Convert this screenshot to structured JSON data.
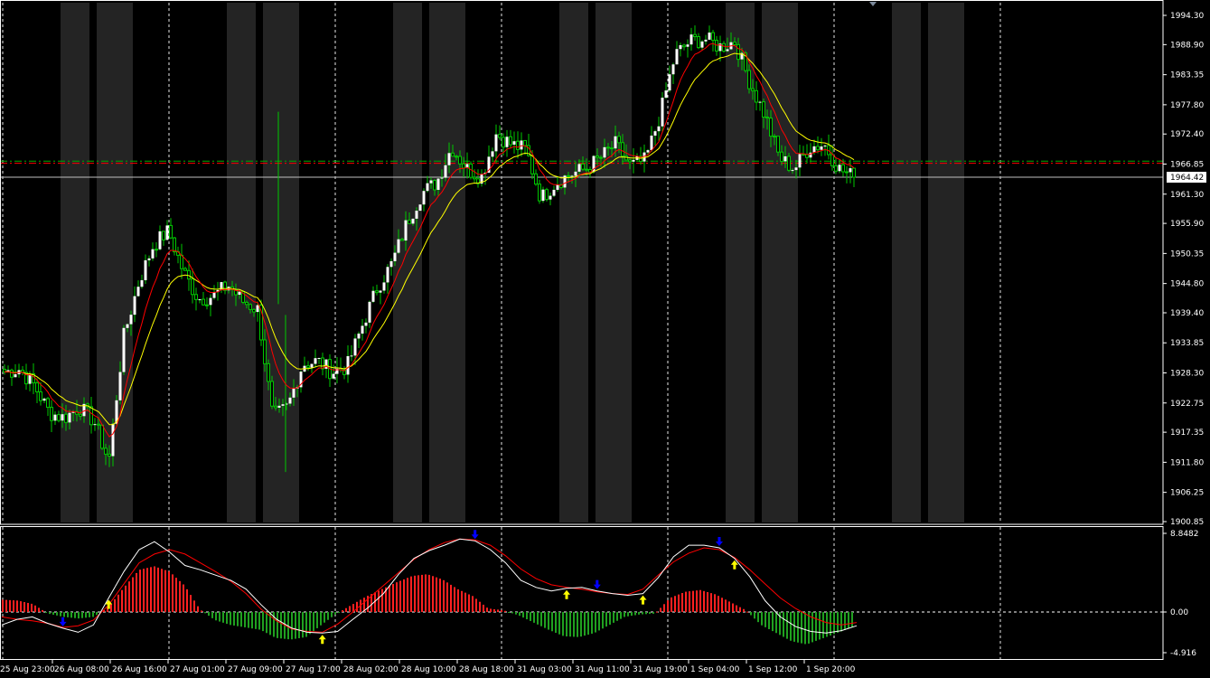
{
  "colors": {
    "background": "#000000",
    "grid": "#ffffff",
    "band": "#242424",
    "bull_candle": "#ffffff",
    "wick": "#00c800",
    "ma_fast": "#ff0000",
    "ma_slow": "#ffff00",
    "hline_green": "#00aa00",
    "hline_red": "#ff0000",
    "current_line": "#c0c0c0",
    "hist_positive": "#ff2020",
    "hist_negative": "#20a020",
    "osc_white": "#ffffff",
    "osc_red": "#ff0000",
    "arrow_up": "#ffff00",
    "arrow_down": "#0000ff"
  },
  "price_axis": {
    "labels": [
      "1994.30",
      "1988.90",
      "1983.35",
      "1977.80",
      "1972.40",
      "1966.85",
      "1961.30",
      "1955.90",
      "1950.35",
      "1944.80",
      "1939.40",
      "1933.85",
      "1928.30",
      "1922.75",
      "1917.35",
      "1911.80",
      "1906.25",
      "1900.85"
    ],
    "current_price": "1964.42",
    "level_green": 1967.4,
    "level_red": 1967.0
  },
  "indicator_axis": {
    "labels": [
      "8.8482",
      "0.00",
      "-4.916"
    ]
  },
  "time_axis": {
    "labels": [
      "25 Aug 23:00",
      "26 Aug 08:00",
      "26 Aug 16:00",
      "27 Aug 01:00",
      "27 Aug 09:00",
      "27 Aug 17:00",
      "28 Aug 02:00",
      "28 Aug 10:00",
      "28 Aug 18:00",
      "31 Aug 03:00",
      "31 Aug 11:00",
      "31 Aug 19:00",
      "1 Sep 04:00",
      "1 Sep 12:00",
      "1 Sep 20:00"
    ]
  },
  "chart_data": {
    "type": "candlestick",
    "ylim": [
      1900.85,
      1995.5
    ],
    "grid": true,
    "x_categories": [
      "25 Aug 23:00",
      "26 Aug 08:00",
      "26 Aug 16:00",
      "27 Aug 01:00",
      "27 Aug 09:00",
      "27 Aug 17:00",
      "28 Aug 02:00",
      "28 Aug 10:00",
      "28 Aug 18:00",
      "31 Aug 03:00",
      "31 Aug 11:00",
      "31 Aug 19:00",
      "1 Sep 04:00",
      "1 Sep 12:00",
      "1 Sep 20:00"
    ],
    "close_path": [
      1928.5,
      1929.0,
      1926.0,
      1921.0,
      1920.0,
      1922.0,
      1919.5,
      1912.0,
      1935.0,
      1945.0,
      1952.0,
      1954.5,
      1947.0,
      1942.0,
      1942.5,
      1944.5,
      1941.5,
      1940.0,
      1920.0,
      1922.0,
      1930.0,
      1930.5,
      1928.5,
      1929.5,
      1937.0,
      1944.0,
      1948.5,
      1956.0,
      1961.5,
      1963.5,
      1970.0,
      1966.0,
      1964.5,
      1972.5,
      1970.5,
      1969.5,
      1960.5,
      1963.5,
      1965.0,
      1966.0,
      1968.0,
      1970.5,
      1966.5,
      1967.5,
      1976.0,
      1987.0,
      1989.5,
      1990.0,
      1988.5,
      1989.5,
      1982.0,
      1976.0,
      1968.0,
      1966.0,
      1970.0,
      1970.5,
      1966.0,
      1964.42
    ],
    "ma_fast_period": "fast",
    "ma_slow_period": "slow",
    "oscillator": {
      "ylim": [
        -4.916,
        8.8482
      ],
      "histogram": [
        1.4,
        1.3,
        0.9,
        -0.2,
        -0.6,
        -0.8,
        -0.6,
        0.6,
        2.8,
        4.8,
        5.2,
        4.6,
        3.0,
        0.3,
        -1.0,
        -1.6,
        -1.9,
        -2.2,
        -3.2,
        -3.4,
        -3.1,
        -1.6,
        -0.2,
        0.8,
        1.8,
        2.6,
        3.4,
        4.1,
        4.3,
        3.7,
        2.6,
        1.8,
        0.4,
        0.2,
        -0.4,
        -1.3,
        -2.2,
        -3.0,
        -3.1,
        -2.6,
        -1.6,
        -0.6,
        -0.3,
        -0.2,
        1.6,
        2.3,
        2.5,
        2.0,
        1.1,
        0.2,
        -1.6,
        -2.6,
        -3.6,
        -4.0,
        -3.3,
        -2.6,
        -1.9
      ],
      "white_line": [
        -1.6,
        -0.9,
        -0.6,
        -1.4,
        -2.0,
        -2.5,
        -1.6,
        1.6,
        4.6,
        7.1,
        8.0,
        6.8,
        5.3,
        4.8,
        4.2,
        3.6,
        2.6,
        0.8,
        -0.9,
        -2.0,
        -2.5,
        -2.6,
        -2.4,
        -0.9,
        0.5,
        2.1,
        4.3,
        6.1,
        7.0,
        7.6,
        8.3,
        8.1,
        7.1,
        5.6,
        3.6,
        2.8,
        2.4,
        2.7,
        2.8,
        2.4,
        2.1,
        1.9,
        2.1,
        3.9,
        6.3,
        7.6,
        7.6,
        7.3,
        6.1,
        4.0,
        1.3,
        -0.6,
        -1.8,
        -2.4,
        -2.6,
        -2.3,
        -1.7
      ],
      "red_line": [
        -0.6,
        -0.9,
        -1.1,
        -1.4,
        -1.9,
        -1.7,
        -1.0,
        0.8,
        3.2,
        5.6,
        6.6,
        7.1,
        6.6,
        5.6,
        4.6,
        3.5,
        2.1,
        0.3,
        -1.1,
        -2.1,
        -2.4,
        -2.5,
        -1.5,
        0.0,
        1.5,
        3.0,
        4.5,
        6.0,
        7.1,
        7.9,
        8.3,
        8.2,
        7.6,
        6.4,
        4.9,
        3.8,
        3.1,
        2.8,
        2.6,
        2.3,
        2.1,
        2.0,
        2.6,
        4.2,
        5.7,
        6.7,
        7.3,
        7.1,
        6.2,
        4.8,
        3.2,
        1.6,
        0.4,
        -0.6,
        -1.3,
        -1.6,
        -1.3
      ],
      "arrows_up_at": [
        7,
        21,
        37,
        42,
        48
      ],
      "arrows_down_at": [
        4,
        31,
        39,
        47
      ]
    }
  }
}
